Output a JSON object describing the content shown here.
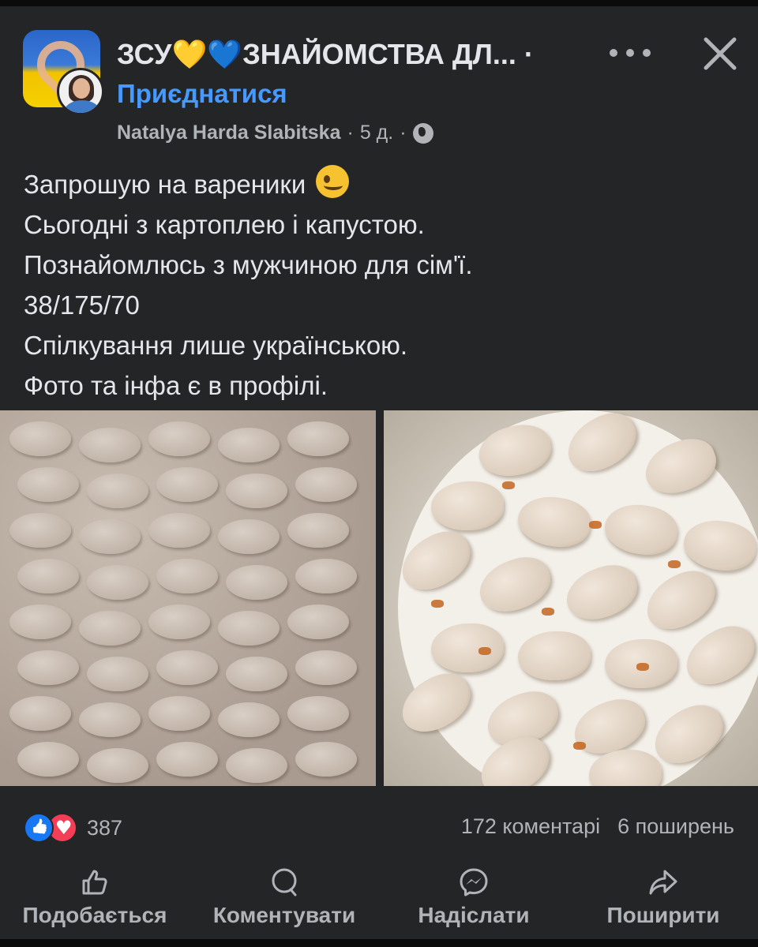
{
  "header": {
    "group_name": "ЗСУ💛💙ЗНАЙОМСТВА ДЛ... ·",
    "join_label": "Приєднатися",
    "author": "Natalya Harda Slabitska",
    "time": "5 д.",
    "separator": "·",
    "icons": {
      "more": "more-horizontal-icon",
      "close": "close-icon",
      "audience": "globe-icon"
    }
  },
  "post": {
    "lines": [
      "Запрошую на вареники",
      "Сьогодні з картоплею і капустою.",
      "Познайомлюсь з мужчиною для сім'ї.",
      "38/175/70",
      "Спілкування лише українською.",
      "Фото та інфа є в профілі."
    ],
    "emoji": "winking-face-emoji"
  },
  "footer": {
    "reactions_count": "387",
    "comments": "172 коментарі",
    "shares": "6 поширень"
  },
  "actions": {
    "like": "Подобається",
    "comment": "Коментувати",
    "send": "Надіслати",
    "share": "Поширити"
  },
  "colors": {
    "background": "#242526",
    "text": "#e4e6eb",
    "secondary_text": "#b0b3b8",
    "link": "#4599ff",
    "like": "#1877f2",
    "love": "#f33e58"
  }
}
